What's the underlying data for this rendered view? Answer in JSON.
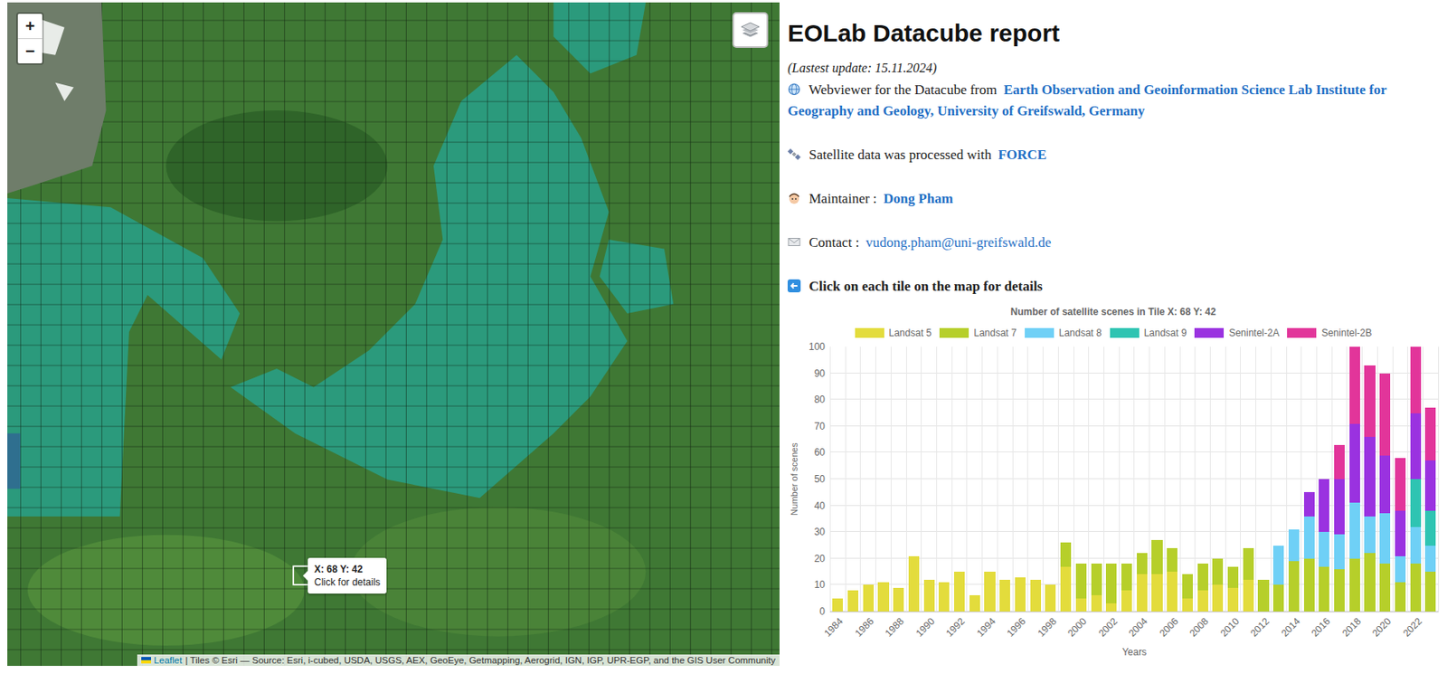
{
  "map": {
    "zoom_in": "+",
    "zoom_out": "−",
    "tooltip": {
      "title": "X: 68 Y: 42",
      "hint": "Click for details"
    },
    "attribution": {
      "link": "Leaflet",
      "text": "| Tiles © Esri — Source: Esri, i-cubed, USDA, USGS, AEX, GeoEye, Getmapping, Aerogrid, IGN, IGP, UPR-EGP, and the GIS User Community"
    }
  },
  "header": {
    "title": "EOLab Datacube report",
    "updated": "(Lastest update: 15.11.2024)"
  },
  "info": [
    {
      "kind": "globe",
      "text": "Webviewer for the Datacube from",
      "link": "Earth Observation and Geoinformation Science Lab Institute for Geography and Geology, University of Greifswald, Germany",
      "link_bold": true
    },
    {
      "kind": "satellite",
      "text": "Satellite data was processed with",
      "link": "FORCE",
      "link_bold": true
    },
    {
      "kind": "person",
      "text": "Maintainer :",
      "link": "Dong Pham",
      "link_bold": true
    },
    {
      "kind": "mail",
      "text": "Contact :",
      "link": "vudong.pham@uni-greifswald.de",
      "link_bold": false
    }
  ],
  "instruction": "Click on each tile on the map for details",
  "chart": {
    "title": "Number of satellite scenes in Tile X: 68 Y: 42",
    "y_title": "Number of scenes",
    "x_title": "Years",
    "y_ticks": [
      "0",
      "10",
      "20",
      "30",
      "40",
      "50",
      "60",
      "70",
      "80",
      "90",
      "100"
    ],
    "x_ticks": [
      "1984",
      "1986",
      "1988",
      "1990",
      "1992",
      "1994",
      "1996",
      "1998",
      "2000",
      "2002",
      "2004",
      "2006",
      "2008",
      "2010",
      "2012",
      "2014",
      "2016",
      "2018",
      "2020",
      "2022"
    ],
    "series": [
      {
        "name": "Landsat 5",
        "color": "#e3dc3c",
        "values": [
          5,
          8,
          10,
          11,
          9,
          21,
          12,
          11,
          15,
          6,
          15,
          12,
          13,
          12,
          10,
          17,
          5,
          6,
          3,
          8,
          14,
          14,
          15,
          5,
          8,
          10,
          9,
          12,
          0,
          0,
          0,
          0,
          0,
          0,
          0,
          0,
          0,
          0,
          0,
          0
        ]
      },
      {
        "name": "Landsat 7",
        "color": "#b6cf2a",
        "values": [
          0,
          0,
          0,
          0,
          0,
          0,
          0,
          0,
          0,
          0,
          0,
          0,
          0,
          0,
          0,
          9,
          13,
          12,
          15,
          10,
          8,
          13,
          9,
          9,
          10,
          10,
          8,
          12,
          12,
          10,
          19,
          20,
          17,
          16,
          20,
          22,
          18,
          11,
          18,
          15
        ]
      },
      {
        "name": "Landsat 8",
        "color": "#6fd0f6",
        "values": [
          0,
          0,
          0,
          0,
          0,
          0,
          0,
          0,
          0,
          0,
          0,
          0,
          0,
          0,
          0,
          0,
          0,
          0,
          0,
          0,
          0,
          0,
          0,
          0,
          0,
          0,
          0,
          0,
          0,
          15,
          12,
          16,
          13,
          13,
          21,
          14,
          19,
          10,
          14,
          10
        ]
      },
      {
        "name": "Landsat 9",
        "color": "#2ec4b2",
        "values": [
          0,
          0,
          0,
          0,
          0,
          0,
          0,
          0,
          0,
          0,
          0,
          0,
          0,
          0,
          0,
          0,
          0,
          0,
          0,
          0,
          0,
          0,
          0,
          0,
          0,
          0,
          0,
          0,
          0,
          0,
          0,
          0,
          0,
          0,
          0,
          0,
          0,
          0,
          18,
          13
        ]
      },
      {
        "name": "Senintel-2A",
        "color": "#9a32e0",
        "values": [
          0,
          0,
          0,
          0,
          0,
          0,
          0,
          0,
          0,
          0,
          0,
          0,
          0,
          0,
          0,
          0,
          0,
          0,
          0,
          0,
          0,
          0,
          0,
          0,
          0,
          0,
          0,
          0,
          0,
          0,
          0,
          9,
          20,
          21,
          30,
          30,
          22,
          17,
          25,
          19
        ]
      },
      {
        "name": "Senintel-2B",
        "color": "#e2359a",
        "values": [
          0,
          0,
          0,
          0,
          0,
          0,
          0,
          0,
          0,
          0,
          0,
          0,
          0,
          0,
          0,
          0,
          0,
          0,
          0,
          0,
          0,
          0,
          0,
          0,
          0,
          0,
          0,
          0,
          0,
          0,
          0,
          0,
          0,
          13,
          33,
          27,
          31,
          20,
          30,
          20
        ]
      }
    ]
  }
}
